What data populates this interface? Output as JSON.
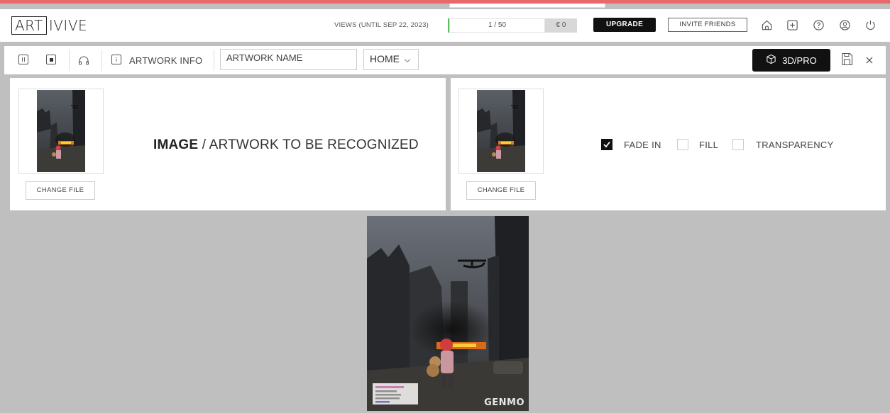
{
  "app": {
    "logo_boxed": "ART",
    "logo_rest": "IVIVE"
  },
  "header": {
    "views_label": "VIEWS (UNTIL SEP 22, 2023)",
    "views_count": "1 / 50",
    "views_used": 1,
    "views_total": 50,
    "price": "€ 0",
    "upgrade_label": "UPGRADE",
    "invite_label": "INVITE FRIENDS",
    "icons": [
      "home-icon",
      "plus-square-icon",
      "help-circle-icon",
      "user-circle-icon",
      "power-icon"
    ]
  },
  "toolbar": {
    "artwork_info_label": "ARTWORK INFO",
    "artwork_name_value": "ARTWORK NAME",
    "home_select_value": "HOME",
    "btn_3d_label": "3D/PRO",
    "icons": [
      "pause-icon",
      "stop-icon",
      "headphones-icon",
      "info-icon",
      "cube-icon",
      "save-icon",
      "close-icon"
    ]
  },
  "left_panel": {
    "heading_bold": "IMAGE",
    "heading_rest": " / ARTWORK TO BE RECOGNIZED",
    "change_file_label": "CHANGE FILE"
  },
  "right_panel": {
    "change_file_label": "CHANGE FILE",
    "options": [
      {
        "label": "FADE IN",
        "checked": true
      },
      {
        "label": "FILL",
        "checked": false
      },
      {
        "label": "TRANSPARENCY",
        "checked": false
      }
    ]
  },
  "preview": {
    "watermark": "GENMO"
  },
  "colors": {
    "accent_red": "#e8696b",
    "progress_green": "#5bbf5b",
    "black": "#111111"
  }
}
